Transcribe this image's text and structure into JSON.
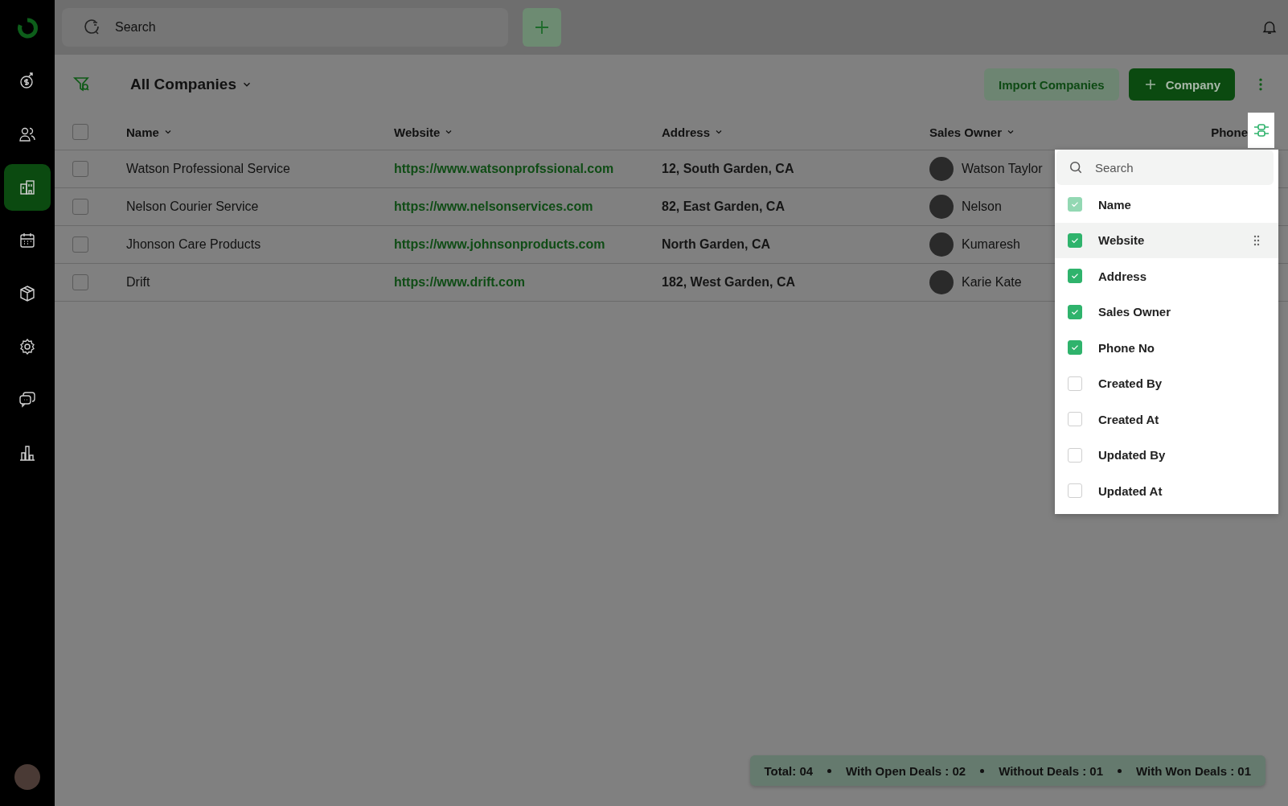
{
  "sidebar": {
    "items": [
      {
        "kind": "deals",
        "selected": false
      },
      {
        "kind": "contacts",
        "selected": false
      },
      {
        "kind": "companies",
        "selected": true
      },
      {
        "kind": "calendar",
        "selected": false
      },
      {
        "kind": "products",
        "selected": false
      },
      {
        "kind": "settings",
        "selected": false
      },
      {
        "kind": "chat",
        "selected": false
      },
      {
        "kind": "reports",
        "selected": false
      }
    ]
  },
  "topbar": {
    "search": {
      "placeholder": "Search"
    }
  },
  "toolbar": {
    "view": "All Companies",
    "buttons": [
      "Import Companies",
      "Company"
    ]
  },
  "table": {
    "all_checked": false,
    "columns": [
      {
        "label": "Name",
        "sortable": true
      },
      {
        "label": "Website",
        "sortable": true
      },
      {
        "label": "Address",
        "sortable": true
      },
      {
        "label": "Sales Owner",
        "sortable": true
      },
      {
        "label": "Phone",
        "sortable": false
      }
    ],
    "rows": [
      {
        "name": "Watson Professional Service",
        "website": "https://www.watsonprofssional.com",
        "address": "12, South Garden, CA",
        "owner": "Watson Taylor",
        "checked": false
      },
      {
        "name": "Nelson Courier Service",
        "website": "https://www.nelsonservices.com",
        "address": "82, East Garden, CA",
        "owner": "Nelson",
        "checked": false
      },
      {
        "name": "Jhonson Care Products",
        "website": "https://www.johnsonproducts.com",
        "address": "North Garden, CA",
        "owner": "Kumaresh",
        "checked": false
      },
      {
        "name": "Drift",
        "website": "https://www.drift.com",
        "address": "182, West Garden, CA",
        "owner": "Karie Kate",
        "checked": false
      }
    ]
  },
  "column_menu": {
    "search": {
      "placeholder": "Search"
    },
    "items": [
      {
        "label": "Name",
        "checked": true,
        "disabled": true,
        "selected": false
      },
      {
        "label": "Website",
        "checked": true,
        "disabled": false,
        "selected": true
      },
      {
        "label": "Address",
        "checked": true,
        "disabled": false,
        "selected": false
      },
      {
        "label": "Sales Owner",
        "checked": true,
        "disabled": false,
        "selected": false
      },
      {
        "label": "Phone No",
        "checked": true,
        "disabled": false,
        "selected": false
      },
      {
        "label": "Created By",
        "checked": false,
        "disabled": false,
        "selected": false
      },
      {
        "label": "Created At",
        "checked": false,
        "disabled": false,
        "selected": false
      },
      {
        "label": "Updated By",
        "checked": false,
        "disabled": false,
        "selected": false
      },
      {
        "label": "Updated At",
        "checked": false,
        "disabled": false,
        "selected": false
      }
    ]
  },
  "summary": [
    "Total: 04",
    "With Open Deals : 02",
    "Without Deals : 01",
    "With Won Deals : 01"
  ]
}
